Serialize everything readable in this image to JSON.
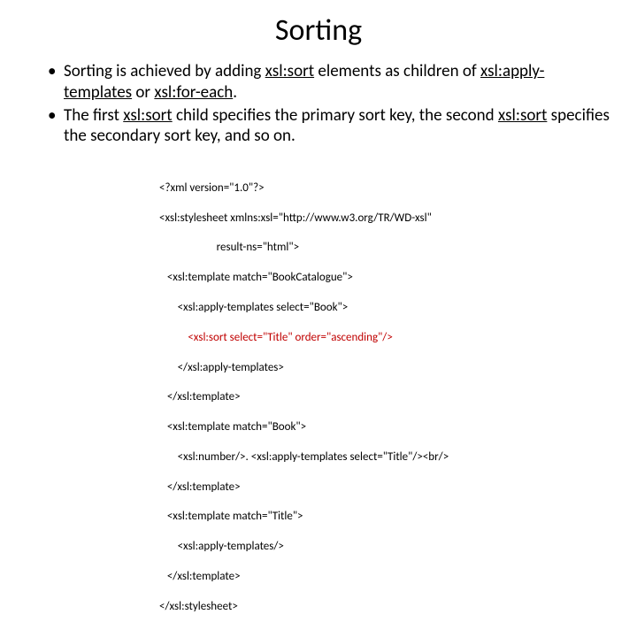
{
  "title": "Sorting",
  "bullets": [
    {
      "pre": "Sorting is achieved by adding ",
      "u1": "xsl:sort",
      "mid1": " elements as children of ",
      "u2": "xsl:apply-templates",
      "mid2": " or ",
      "u3": "xsl:for-each",
      "post": "."
    },
    {
      "pre": "The first ",
      "u1": "xsl:sort",
      "mid1": " child specifies the primary sort key, the second ",
      "u2": "xsl:sort",
      "mid2": " specifies the secondary sort key, and so on.",
      "u3": "",
      "post": ""
    }
  ],
  "code": {
    "l01": "<?xml version=\"1.0\"?>",
    "l02": "<xsl:stylesheet xmlns:xsl=\"http://www.w3.org/TR/WD-xsl\"",
    "l03": "                      result-ns=\"html\">",
    "l04": "   <xsl:template match=\"BookCatalogue\">",
    "l05": "       <xsl:apply-templates select=\"Book\">",
    "l06_red": "           <xsl:sort select=\"Title\" order=\"ascending\"/>",
    "l07": "       </xsl:apply-templates>",
    "l08": "   </xsl:template>",
    "l09": "   <xsl:template match=\"Book\">",
    "l10": "       <xsl:number/>. <xsl:apply-templates select=\"Title\"/><br/>",
    "l11": "   </xsl:template>",
    "l12": "   <xsl:template match=\"Title\">",
    "l13": "       <xsl:apply-templates/>",
    "l14": "   </xsl:template>",
    "l15": "</xsl:stylesheet>"
  }
}
